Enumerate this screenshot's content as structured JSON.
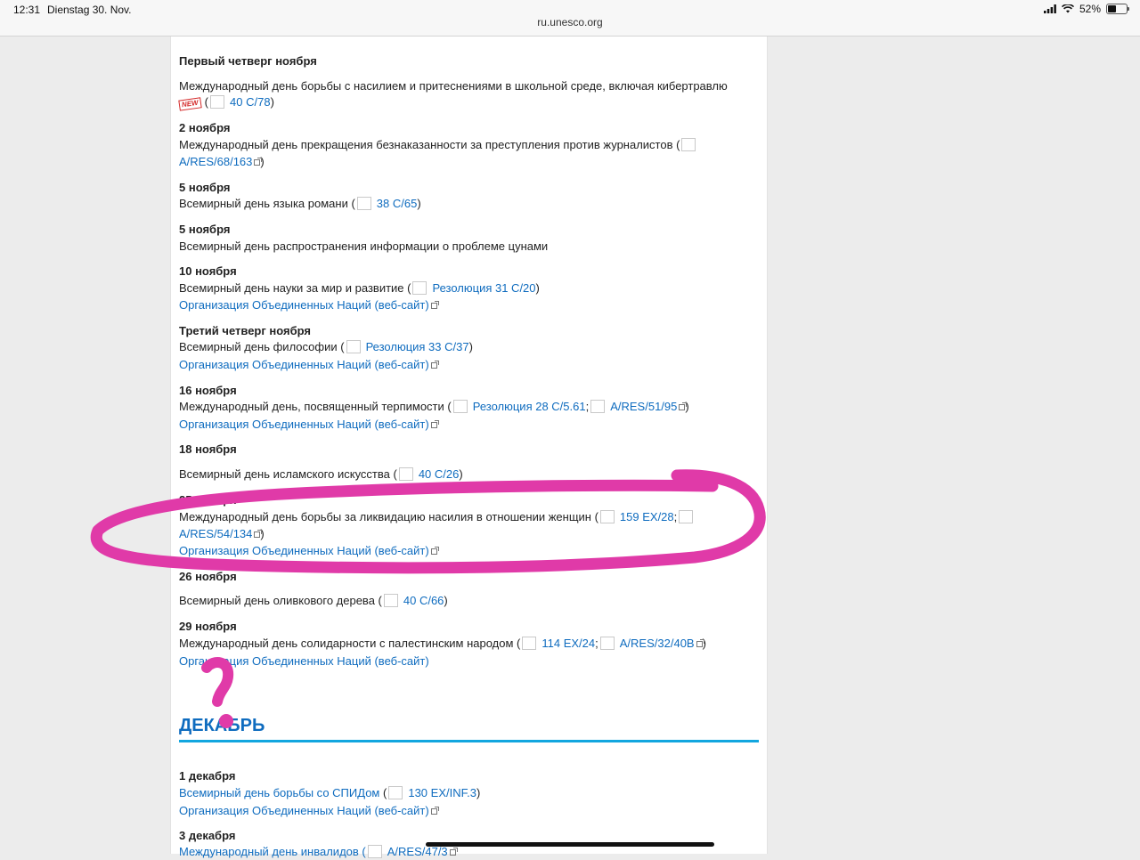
{
  "status": {
    "time": "12:31",
    "date": "Dienstag 30. Nov.",
    "url": "ru.unesco.org",
    "battery": "52%",
    "battery_level": 0.52
  },
  "entries": [
    {
      "date": "Первый четверг ноября",
      "title": "Международный день борьбы с насилием и притеснениями в школьной среде, включая кибертравлю",
      "badge": "NEW",
      "ref1": "40 C/78"
    },
    {
      "date": "2 ноября",
      "title": "Международный день прекращения безнаказанности за преступления против журналистов (",
      "ref1": "A/RES/68/163"
    },
    {
      "date": "5 ноября",
      "title": "Всемирный день языка романи (",
      "ref1": "38 C/65"
    },
    {
      "date": "5 ноября",
      "title": "Всемирный день распространения информации о проблеме цунами"
    },
    {
      "date": "10 ноября",
      "title": "Всемирный день науки за мир и развитие (",
      "ref1": "Резолюция 31 C/20",
      "un": "Организация Объединенных Наций (веб-сайт)"
    },
    {
      "date": "Третий четверг ноября",
      "title": "Всемирный день философии (",
      "ref1": "Резолюция 33 C/37",
      "un": "Организация Объединенных Наций (веб-сайт)"
    },
    {
      "date": "16 ноября",
      "title": "Международный день, посвященный терпимости (",
      "ref1": "Резолюция 28 C/5.61",
      "ref2": "A/RES/51/95",
      "un": "Организация Объединенных Наций (веб-сайт)"
    },
    {
      "date": "18 ноября",
      "title": "Всемирный день исламского искусства (",
      "ref1": "40 C/26"
    },
    {
      "date": "25 ноября",
      "title": "Международный день борьбы за ликвидацию насилия в отношении женщин (",
      "ref1": "159 EX/28",
      "ref2": "A/RES/54/134",
      "un": "Организация Объединенных Наций (веб-сайт)"
    },
    {
      "date": "26 ноября",
      "title": "Всемирный день оливкового дерева (",
      "ref1": "40 C/66"
    },
    {
      "date": "29 ноября",
      "title": "Международный день солидарности с палестинским народом (",
      "ref1": "114 EX/24",
      "ref2": "A/RES/32/40B",
      "un": "Организация Объединенных Наций (веб-сайт)"
    }
  ],
  "december": {
    "heading": "ДЕКАБРЬ",
    "entries": [
      {
        "date": "1 декабря",
        "title": "Всемирный день борьбы со СПИДом",
        "ref1": "130 EX/INF.3",
        "un": "Организация Объединенных Наций (веб-сайт)"
      },
      {
        "date": "3 декабря",
        "title": "Международный день инвалидов (",
        "ref1": "A/RES/47/3"
      }
    ]
  },
  "punct": {
    "open": "(",
    "close": ")",
    "sep": ";",
    "close_open_link": ")"
  },
  "annotation_color": "#e03aa8"
}
